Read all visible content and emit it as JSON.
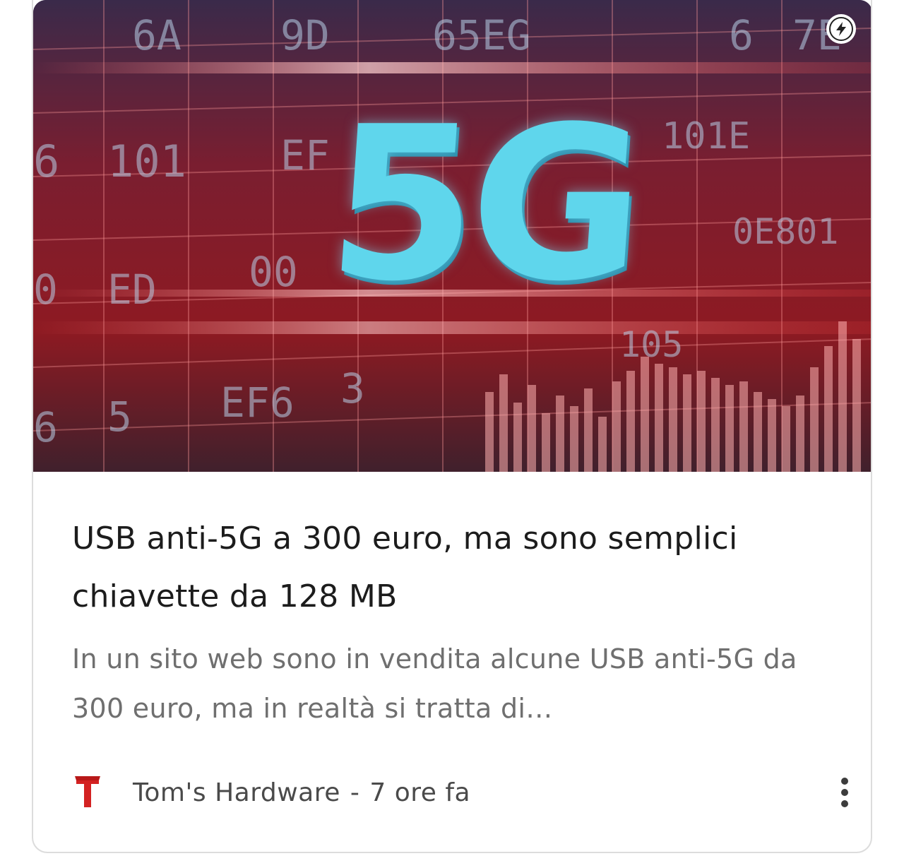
{
  "article": {
    "image": {
      "headline_text": "5G",
      "background_codes": [
        "6A",
        "9D",
        "65EG",
        "6",
        "7E",
        "101",
        "EF",
        "101E",
        "0E801",
        "ED",
        "00",
        "105",
        "EF6",
        "3",
        "5",
        "6",
        "0"
      ]
    },
    "title": "USB anti-5G a 300 euro, ma sono semplici chiavette da 128 MB",
    "snippet": "In un sito web sono in vendita alcune USB anti-5G da 300 euro, ma in realtà si tratta di…",
    "source": "Tom's Hardware",
    "separator": "-",
    "age": "7 ore fa",
    "source_logo_letter": "T"
  },
  "icons": {
    "amp": "lightning-bolt-icon",
    "more": "more-vertical-icon",
    "source_logo": "toms-hardware-logo"
  },
  "colors": {
    "logo_red": "#d32222",
    "title": "#1c1c1c",
    "snippet": "#6f6f6f",
    "five_g_cyan": "#5fd6ec"
  }
}
